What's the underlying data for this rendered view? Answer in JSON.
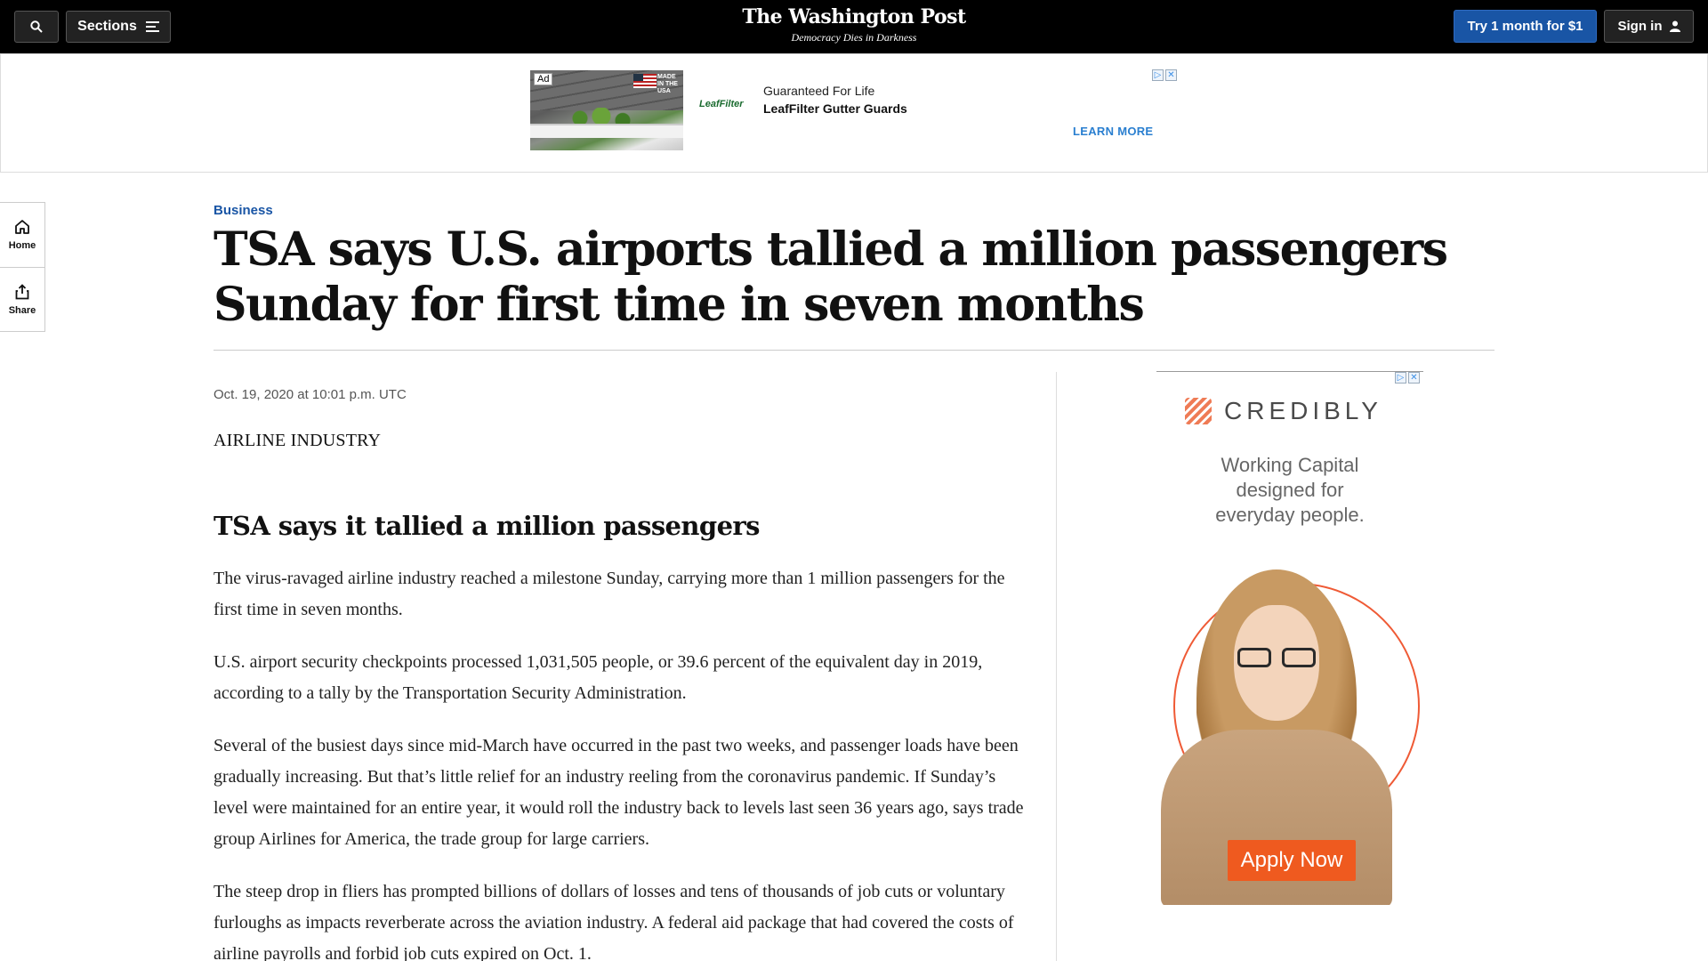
{
  "header": {
    "sections_label": "Sections",
    "logo": "The Washington Post",
    "tagline": "Democracy Dies in Darkness",
    "subscribe_label": "Try 1 month for $1",
    "signin_label": "Sign in"
  },
  "top_ad": {
    "ad_badge": "Ad",
    "made_in": "MADE IN THE USA",
    "brand": "LeafFilter",
    "line1": "Guaranteed For Life",
    "line2": "LeafFilter Gutter Guards",
    "cta": "LEARN MORE"
  },
  "rail": {
    "home_label": "Home",
    "share_label": "Share"
  },
  "article": {
    "kicker": "Business",
    "headline": "TSA says U.S. airports tallied a million passengers Sunday for first time in seven months",
    "timestamp": "Oct. 19, 2020 at 10:01 p.m. UTC",
    "label": "AIRLINE INDUSTRY",
    "subhead": "TSA says it tallied a million passengers",
    "paragraphs": [
      "The virus-ravaged airline industry reached a milestone Sunday, carrying more than 1 million passengers for the first time in seven months.",
      "U.S. airport security checkpoints processed 1,031,505 people, or 39.6 percent of the equivalent day in 2019, according to a tally by the Transportation Security Administration.",
      "Several of the busiest days since mid-March have occurred in the past two weeks, and passenger loads have been gradually increasing. But that’s little relief for an industry reeling from the coronavirus pandemic. If Sunday’s level were maintained for an entire year, it would roll the industry back to levels last seen 36 years ago, says trade group Airlines for America, the trade group for large carriers.",
      "The steep drop in fliers has prompted billions of dollars of losses and tens of thousands of job cuts or voluntary furloughs as impacts reverberate across the aviation industry. A federal aid package that had covered the costs of airline payrolls and forbid job cuts expired on Oct. 1."
    ]
  },
  "side_ad": {
    "brand": "CREDIBLY",
    "copy_line1": "Working Capital",
    "copy_line2": "designed for",
    "copy_line3": "everyday people.",
    "cta": "Apply Now"
  },
  "colors": {
    "brand_blue": "#1955a5",
    "ad_orange": "#ef5a1f"
  }
}
